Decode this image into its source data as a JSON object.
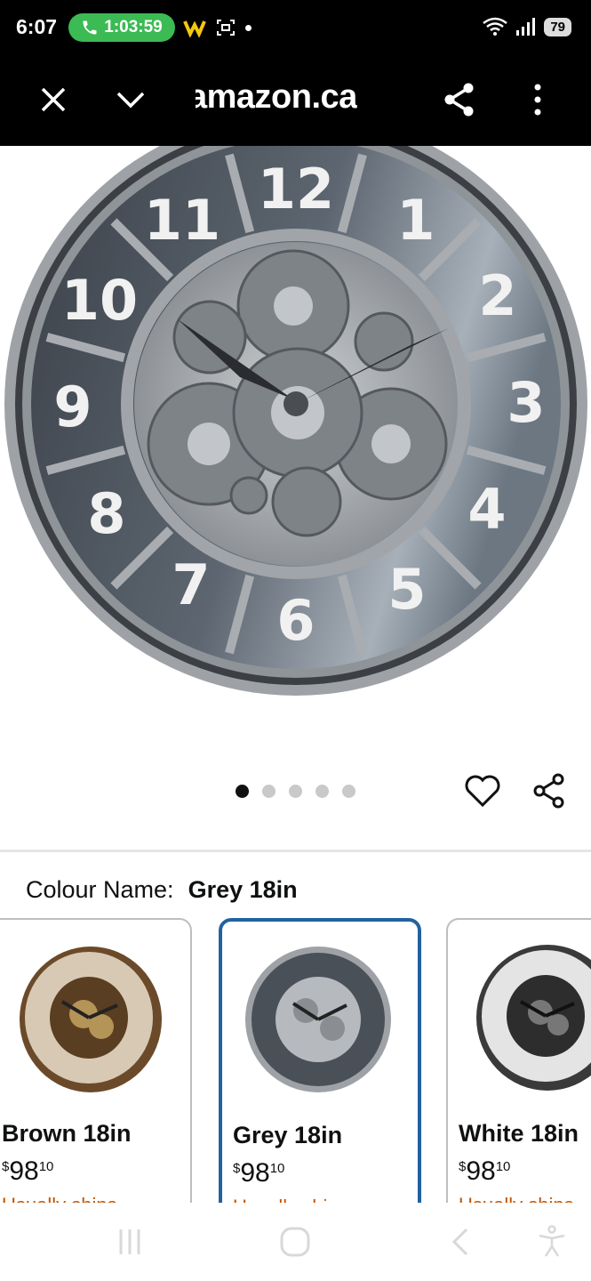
{
  "status_bar": {
    "time": "6:07",
    "call_timer": "1:03:59",
    "battery": "79",
    "wifi_label": "6"
  },
  "browser": {
    "url_text": "amazon.ca"
  },
  "product": {
    "image_count": 5,
    "active_image_index": 0,
    "colour_label": "Colour Name:",
    "colour_value": "Grey 18in"
  },
  "variants": [
    {
      "name": "Brown 18in",
      "currency": "$",
      "price_whole": "98",
      "price_fraction": "10",
      "shipping": "Usually ships",
      "selected": false
    },
    {
      "name": "Grey 18in",
      "currency": "$",
      "price_whole": "98",
      "price_fraction": "10",
      "shipping": "Usually ships",
      "selected": true
    },
    {
      "name": "White 18in",
      "currency": "$",
      "price_whole": "98",
      "price_fraction": "10",
      "shipping": "Usually ships",
      "selected": false
    }
  ],
  "icons": {
    "close": "close-icon",
    "collapse": "chevron-down-icon",
    "share": "share-icon",
    "more": "more-vert-icon",
    "wishlist": "heart-icon",
    "product_share": "share-icon"
  },
  "colors": {
    "selected_border": "#2162a1",
    "shipping_text": "#c45500",
    "call_pill": "#3cba54"
  }
}
